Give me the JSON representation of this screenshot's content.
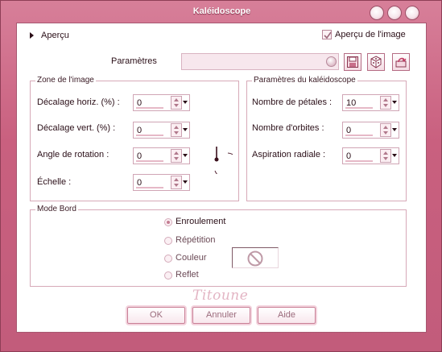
{
  "window": {
    "title": "Kaléidoscope"
  },
  "preview": {
    "label": "Aperçu",
    "checkbox_label": "Aperçu de l'image",
    "checked": true
  },
  "presets": {
    "label": "Paramètres",
    "value": ""
  },
  "image_zone": {
    "title": "Zone de l'image",
    "fields": [
      {
        "label": "Décalage horiz. (%) :",
        "value": "0"
      },
      {
        "label": "Décalage vert. (%) :",
        "value": "0"
      },
      {
        "label": "Angle de rotation :",
        "value": "0"
      },
      {
        "label": "Échelle :",
        "value": "0"
      }
    ]
  },
  "kaleido": {
    "title": "Paramètres du kaléidoscope",
    "fields": [
      {
        "label": "Nombre de pétales :",
        "value": "10"
      },
      {
        "label": "Nombre d'orbites :",
        "value": "0"
      },
      {
        "label": "Aspiration radiale :",
        "value": "0"
      }
    ]
  },
  "edge_mode": {
    "title": "Mode Bord",
    "options": [
      {
        "label": "Enroulement",
        "selected": true
      },
      {
        "label": "Répétition",
        "selected": false
      },
      {
        "label": "Couleur",
        "selected": false
      },
      {
        "label": "Reflet",
        "selected": false
      }
    ]
  },
  "watermark": "Titoune",
  "buttons": {
    "ok": "OK",
    "cancel": "Annuler",
    "help": "Aide"
  },
  "colors": {
    "accent": "#c9607f",
    "border": "#d7a9b8"
  },
  "icons": [
    "close-icon",
    "maximize-icon",
    "minimize-icon",
    "save-preset-icon",
    "random-dice-icon",
    "reset-icon",
    "no-color-icon",
    "rotation-dial-icon"
  ]
}
